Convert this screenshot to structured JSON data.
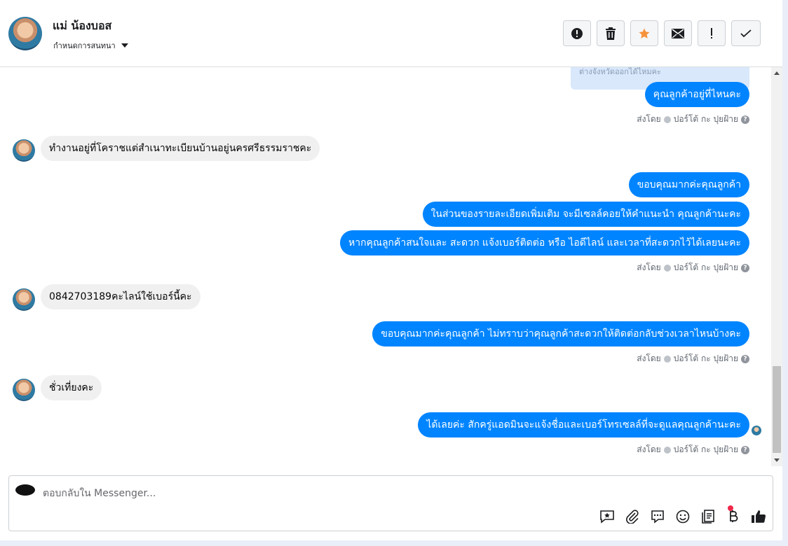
{
  "header": {
    "contact_name": "แม่ น้องบอส",
    "assign_label": "กำหนดการสนทนา",
    "actions": [
      {
        "icon": "alert-circle-icon"
      },
      {
        "icon": "trash-icon"
      },
      {
        "icon": "star-icon",
        "color": "#f7923b"
      },
      {
        "icon": "envelope-icon"
      },
      {
        "icon": "exclamation-icon"
      },
      {
        "icon": "check-icon"
      }
    ]
  },
  "conversation": {
    "quoted_text": "ต่างจังหวัดออกได้ไหมคะ",
    "sent_by_label": "ส่งโดย",
    "agent_name": "ปอร์โต้ กะ ปุยฝ้าย",
    "messages": [
      {
        "from": "page",
        "text": "คุณลูกค้าอยู่ที่ไหนคะ"
      },
      {
        "from": "customer",
        "text": "ทำงานอยู่ที่โคราชแต่สำเนาทะเบียนบ้านอยู่นครศรีธรรมราชคะ"
      },
      {
        "from": "page",
        "text": "ขอบคุณมากค่ะคุณลูกค้า"
      },
      {
        "from": "page",
        "text": "ในส่วนของรายละเอียดเพิ่มเติม จะมีเซลล์คอยให้คำแนะนำ คุณลูกค้านะคะ"
      },
      {
        "from": "page",
        "text": "หากคุณลูกค้าสนใจและ สะดวก แจ้งเบอร์ติดต่อ หรือ ไอดีไลน์ และเวลาที่สะดวกไว้ได้เลยนะคะ"
      },
      {
        "from": "customer",
        "text": "0842703189คะไลน์ใช้เบอร์นี้คะ"
      },
      {
        "from": "page",
        "text": "ขอบคุณมากค่ะคุณลูกค้า ไม่ทราบว่าคุณลูกค้าสะดวกให้ติดต่อกลับช่วงเวลาไหนบ้างคะ"
      },
      {
        "from": "customer",
        "text": "ชั่วเที่ยงคะ"
      },
      {
        "from": "page",
        "text": "ได้เลยค่ะ สักครู่แอดมินจะแจ้งชื่อและเบอร์โทรเซลล์ที่จะดูแลคุณลูกค้านะคะ"
      }
    ]
  },
  "composer": {
    "placeholder": "ตอบกลับใน Messenger...",
    "tools": [
      "saved-reply-icon",
      "attachment-icon",
      "chat-bubble-icon",
      "emoji-icon",
      "catalog-icon",
      "baht-payment-icon",
      "thumbs-up-icon"
    ]
  },
  "colors": {
    "outgoing_bubble": "#0084ff",
    "incoming_bubble": "#f0f0f0",
    "notification_dot": "#f02849"
  }
}
